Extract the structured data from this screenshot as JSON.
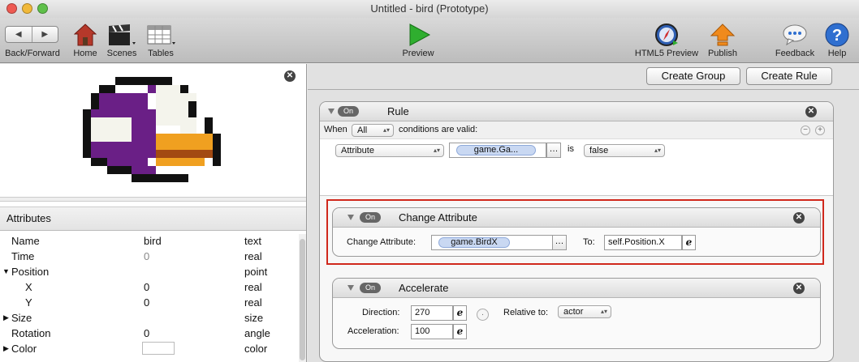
{
  "window": {
    "title": "Untitled - bird (Prototype)"
  },
  "toolbar": {
    "back_forward": "Back/Forward",
    "home": "Home",
    "scenes": "Scenes",
    "tables": "Tables",
    "preview": "Preview",
    "html5_preview": "HTML5 Preview",
    "publish": "Publish",
    "feedback": "Feedback",
    "help": "Help"
  },
  "attributes": {
    "header": "Attributes",
    "rows": [
      {
        "name": "Name",
        "value": "bird",
        "type": "text"
      },
      {
        "name": "Time",
        "value": "0",
        "type": "real"
      },
      {
        "name": "Position",
        "value": "",
        "type": "point"
      },
      {
        "name": "X",
        "value": "0",
        "type": "real"
      },
      {
        "name": "Y",
        "value": "0",
        "type": "real"
      },
      {
        "name": "Size",
        "value": "",
        "type": "size"
      },
      {
        "name": "Rotation",
        "value": "0",
        "type": "angle"
      },
      {
        "name": "Color",
        "value": "",
        "type": "color"
      }
    ]
  },
  "actions": {
    "create_group": "Create Group",
    "create_rule": "Create Rule"
  },
  "rule": {
    "on": "On",
    "title": "Rule",
    "when": "When",
    "when_option": "All",
    "conditions_text": "conditions are valid:",
    "condition_type": "Attribute",
    "condition_attr": "game.Ga...",
    "is": "is",
    "condition_value": "false"
  },
  "change_attribute": {
    "on": "On",
    "title": "Change Attribute",
    "label": "Change Attribute:",
    "attr": "game.BirdX",
    "to_label": "To:",
    "to_value": "self.Position.X"
  },
  "accelerate": {
    "on": "On",
    "title": "Accelerate",
    "direction_label": "Direction:",
    "direction": "270",
    "relative_label": "Relative to:",
    "relative": "actor",
    "acceleration_label": "Acceleration:",
    "acceleration": "100"
  },
  "colors": {
    "accent": "#d0281c",
    "bird_body": "#6a1f86"
  }
}
